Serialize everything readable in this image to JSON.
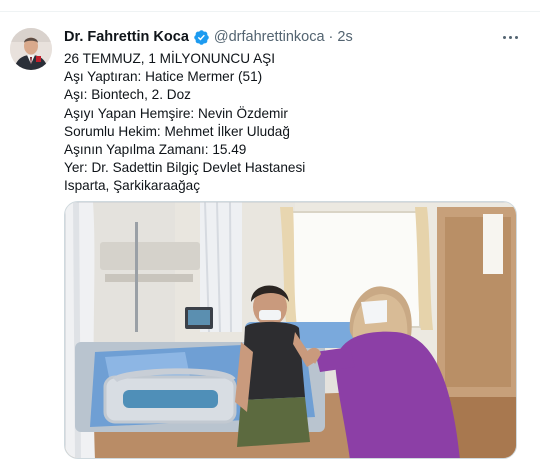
{
  "tweet": {
    "author": {
      "display_name": "Dr. Fahrettin Koca",
      "handle": "@drfahrettinkoca",
      "verified": true
    },
    "separator": "·",
    "timestamp": "2s",
    "text_lines": [
      "26 TEMMUZ, 1 MİLYONUNCU AŞI",
      "Aşı Yaptıran: Hatice Mermer (51)",
      "Aşı: Biontech, 2. Doz",
      "Aşıyı Yapan Hemşire: Nevin Özdemir",
      "Sorumlu Hekim: Mehmet İlker Uludağ",
      "Aşının Yapılma Zamanı: 15.49",
      "Yer: Dr. Sadettin Bilgiç Devlet Hastanesi",
      "Isparta, Şarkikaraağaç"
    ],
    "more_icon": "more-horizontal-icon",
    "media_icon": "photo-vaccination-hospital-room"
  },
  "colors": {
    "text_primary": "#0f1419",
    "text_secondary": "#536471",
    "verified_blue": "#1d9bf0",
    "border": "#cfd9de"
  }
}
